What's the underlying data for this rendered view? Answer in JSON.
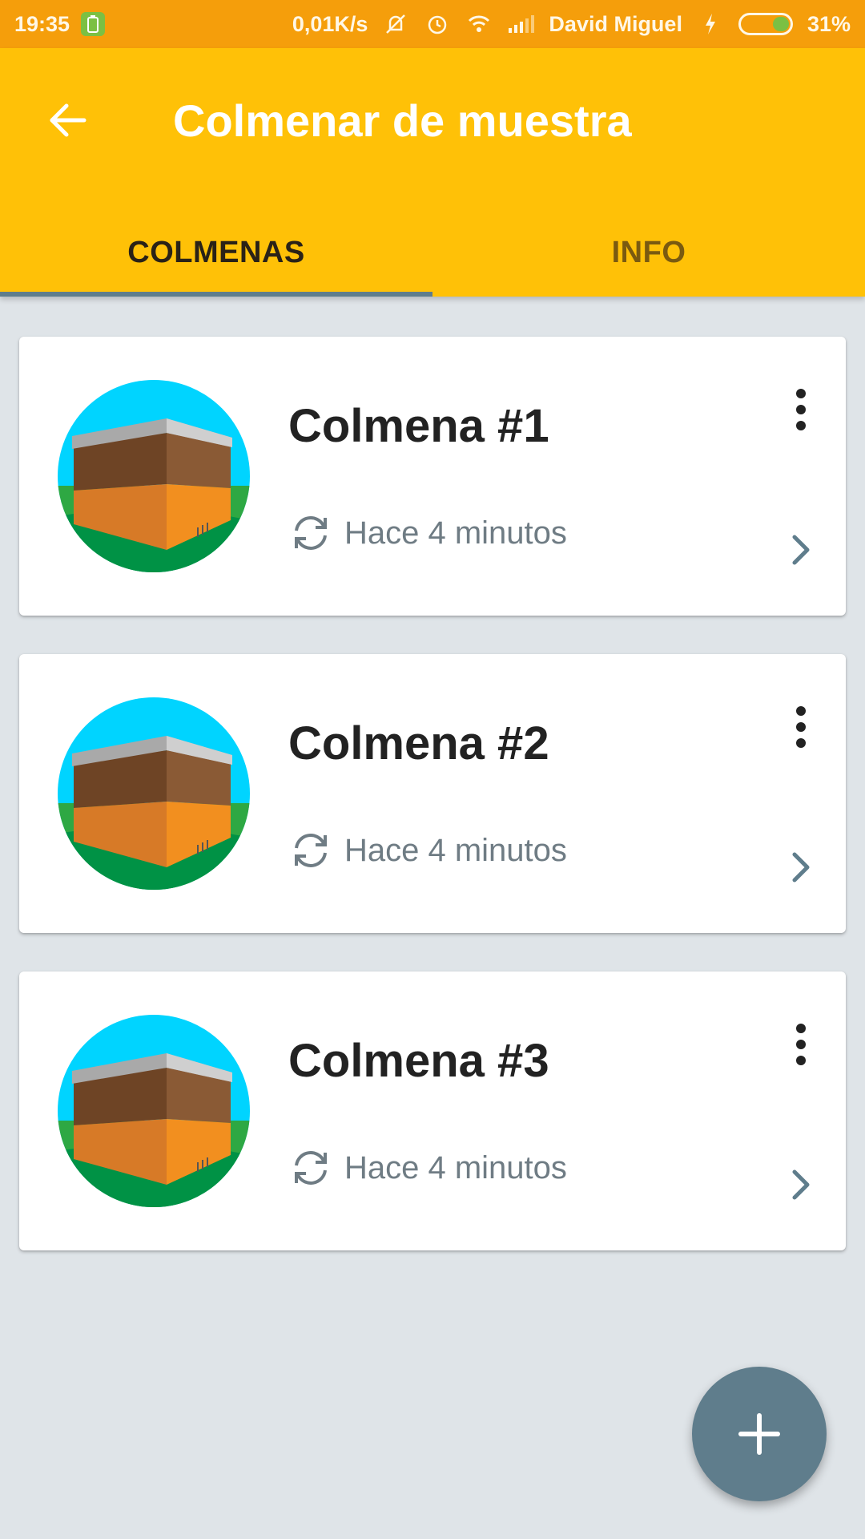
{
  "status_bar": {
    "time": "19:35",
    "network_speed": "0,01K/s",
    "carrier": "David Miguel",
    "battery_percent": "31%",
    "battery_level": 0.31,
    "icons": [
      "battery-saver-icon",
      "muted-vibrate-icon",
      "alarm-icon",
      "wifi-icon",
      "signal-icon",
      "charging-icon"
    ]
  },
  "appbar": {
    "title": "Colmenar de muestra",
    "back_icon": "arrow-back-icon",
    "tabs": [
      {
        "label": "COLMENAS",
        "active": true
      },
      {
        "label": "INFO",
        "active": false
      }
    ]
  },
  "hives": [
    {
      "name": "Colmena #1",
      "updated": "Hace 4 minutos"
    },
    {
      "name": "Colmena #2",
      "updated": "Hace 4 minutos"
    },
    {
      "name": "Colmena #3",
      "updated": "Hace 4 minutos"
    }
  ],
  "fab": {
    "icon": "plus-icon"
  },
  "colors": {
    "status_bar": "#f59e0b",
    "appbar": "#ffc107",
    "accent": "#5f7d8c",
    "background": "#dfe4e8"
  }
}
